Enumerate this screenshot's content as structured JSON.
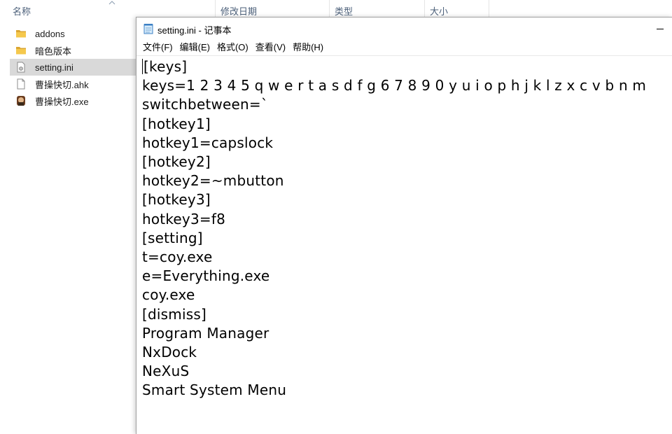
{
  "explorer": {
    "columns": {
      "name": "名称",
      "modified": "修改日期",
      "type": "类型",
      "size": "大小"
    },
    "files": [
      {
        "name": "addons",
        "icon": "folder-icon"
      },
      {
        "name": "暗色版本",
        "icon": "folder-icon"
      },
      {
        "name": "setting.ini",
        "icon": "ini-file-icon",
        "selected": true
      },
      {
        "name": "曹操快切.ahk",
        "icon": "text-file-icon"
      },
      {
        "name": "曹操快切.exe",
        "icon": "exe-app-icon"
      }
    ]
  },
  "notepad": {
    "title": "setting.ini - 记事本",
    "menu": [
      "文件(F)",
      "编辑(E)",
      "格式(O)",
      "查看(V)",
      "帮助(H)"
    ],
    "lines": [
      "[keys]",
      "keys=1 2 3 4 5 q w e r t a s d f g 6 7 8 9 0 y u i o p h j k l z x c v b n m",
      "switchbetween=`",
      "[hotkey1]",
      "hotkey1=capslock",
      "[hotkey2]",
      "hotkey2=~mbutton",
      "[hotkey3]",
      "hotkey3=f8",
      "[setting]",
      "t=coy.exe",
      "e=Everything.exe",
      "coy.exe",
      "[dismiss]",
      "Program Manager",
      "NxDock",
      "NeXuS",
      "Smart System Menu"
    ]
  },
  "colors": {
    "folder": "#f2c14e",
    "header_text": "#4c607a",
    "selected_row": "#d9d9d9"
  }
}
